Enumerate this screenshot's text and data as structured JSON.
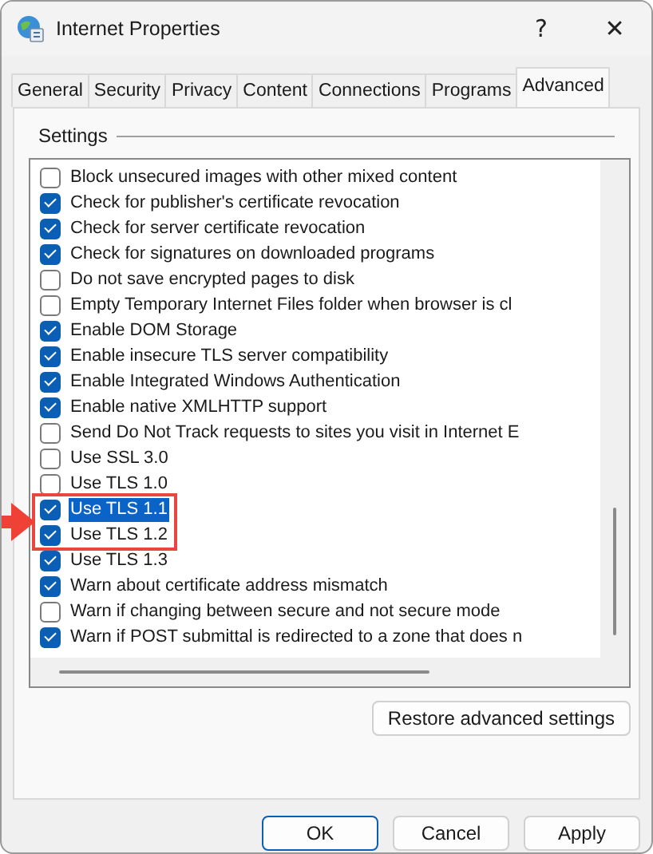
{
  "window": {
    "title": "Internet Properties",
    "help_button": "?",
    "close_button": "✕"
  },
  "tabs": [
    {
      "label": "General",
      "selected": false
    },
    {
      "label": "Security",
      "selected": false
    },
    {
      "label": "Privacy",
      "selected": false
    },
    {
      "label": "Content",
      "selected": false
    },
    {
      "label": "Connections",
      "selected": false
    },
    {
      "label": "Programs",
      "selected": false
    },
    {
      "label": "Advanced",
      "selected": true
    }
  ],
  "settings": {
    "heading": "Settings",
    "items": [
      {
        "label": "Block unsecured images with other mixed content",
        "checked": false,
        "selected": false,
        "marked": false
      },
      {
        "label": "Check for publisher's certificate revocation",
        "checked": true,
        "selected": false,
        "marked": false
      },
      {
        "label": "Check for server certificate revocation",
        "checked": true,
        "selected": false,
        "marked": false
      },
      {
        "label": "Check for signatures on downloaded programs",
        "checked": true,
        "selected": false,
        "marked": false
      },
      {
        "label": "Do not save encrypted pages to disk",
        "checked": false,
        "selected": false,
        "marked": false
      },
      {
        "label": "Empty Temporary Internet Files folder when browser is cl",
        "checked": false,
        "selected": false,
        "marked": false
      },
      {
        "label": "Enable DOM Storage",
        "checked": true,
        "selected": false,
        "marked": false
      },
      {
        "label": "Enable insecure TLS server compatibility",
        "checked": true,
        "selected": false,
        "marked": false
      },
      {
        "label": "Enable Integrated Windows Authentication",
        "checked": true,
        "selected": false,
        "marked": false
      },
      {
        "label": "Enable native XMLHTTP support",
        "checked": true,
        "selected": false,
        "marked": false
      },
      {
        "label": "Send Do Not Track requests to sites you visit in Internet E",
        "checked": false,
        "selected": false,
        "marked": false
      },
      {
        "label": "Use SSL 3.0",
        "checked": false,
        "selected": false,
        "marked": false
      },
      {
        "label": "Use TLS 1.0",
        "checked": false,
        "selected": false,
        "marked": false
      },
      {
        "label": "Use TLS 1.1",
        "checked": true,
        "selected": true,
        "marked": true
      },
      {
        "label": "Use TLS 1.2",
        "checked": true,
        "selected": false,
        "marked": true
      },
      {
        "label": "Use TLS 1.3",
        "checked": true,
        "selected": false,
        "marked": false
      },
      {
        "label": "Warn about certificate address mismatch",
        "checked": true,
        "selected": false,
        "marked": false
      },
      {
        "label": "Warn if changing between secure and not secure mode",
        "checked": false,
        "selected": false,
        "marked": false
      },
      {
        "label": "Warn if POST submittal is redirected to a zone that does n",
        "checked": true,
        "selected": false,
        "marked": false
      }
    ],
    "restore_button": "Restore advanced settings"
  },
  "buttons": [
    {
      "label": "OK",
      "default": true
    },
    {
      "label": "Cancel",
      "default": false
    },
    {
      "label": "Apply",
      "default": false
    }
  ]
}
